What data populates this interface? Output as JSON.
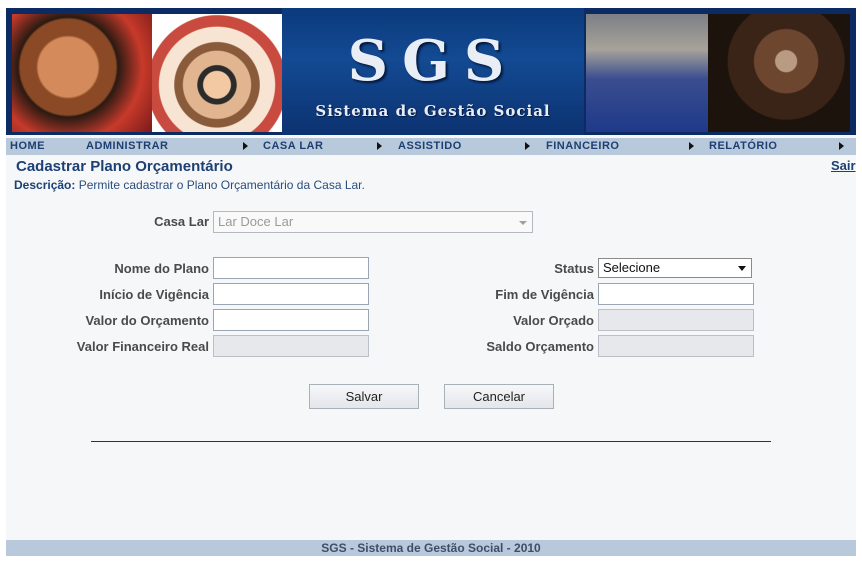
{
  "banner": {
    "logo": "SGS",
    "subtitle": "Sistema de Gestão Social"
  },
  "nav": {
    "items": [
      "HOME",
      "ADMINISTRAR",
      "CASA LAR",
      "ASSISTIDO",
      "FINANCEIRO",
      "RELATÓRIO"
    ]
  },
  "page": {
    "title": "Cadastrar Plano Orçamentário",
    "logout": "Sair",
    "description_label": "Descrição:",
    "description_text": " Permite cadastrar o Plano Orçamentário da Casa Lar."
  },
  "form": {
    "casa_lar": {
      "label": "Casa Lar",
      "value": "Lar Doce Lar"
    },
    "nome_plano": {
      "label": "Nome do Plano",
      "value": ""
    },
    "inicio_vigencia": {
      "label": "Início de Vigência",
      "value": ""
    },
    "valor_orcamento": {
      "label": "Valor do Orçamento",
      "value": ""
    },
    "valor_financeiro_real": {
      "label": "Valor Financeiro Real",
      "value": ""
    },
    "status": {
      "label": "Status",
      "value": "Selecione"
    },
    "fim_vigencia": {
      "label": "Fim de Vigência",
      "value": ""
    },
    "valor_orcado": {
      "label": "Valor Orçado",
      "value": ""
    },
    "saldo_orcamento": {
      "label": "Saldo Orçamento",
      "value": ""
    }
  },
  "buttons": {
    "save": "Salvar",
    "cancel": "Cancelar"
  },
  "footer": {
    "text": "SGS - Sistema de Gestão Social - 2010"
  }
}
